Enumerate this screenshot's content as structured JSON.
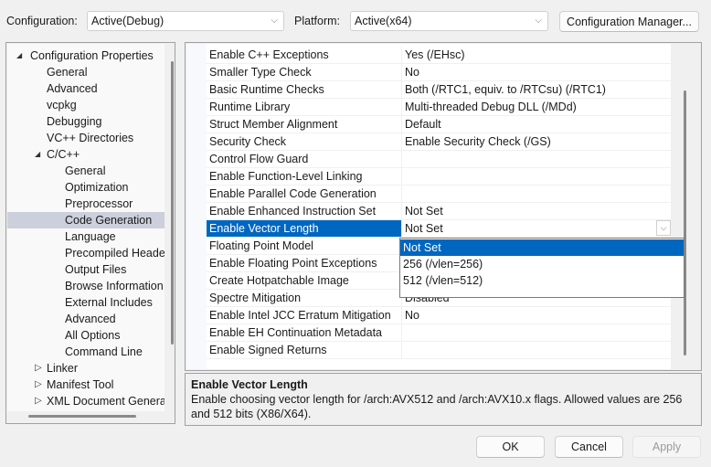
{
  "toolbar": {
    "configuration_label": "Configuration:",
    "configuration_value": "Active(Debug)",
    "platform_label": "Platform:",
    "platform_value": "Active(x64)",
    "config_manager_button": "Configuration Manager..."
  },
  "tree": {
    "nodes": [
      {
        "label": "Configuration Properties",
        "level": 0,
        "expander": "expanded"
      },
      {
        "label": "General",
        "level": 1
      },
      {
        "label": "Advanced",
        "level": 1
      },
      {
        "label": "vcpkg",
        "level": 1
      },
      {
        "label": "Debugging",
        "level": 1
      },
      {
        "label": "VC++ Directories",
        "level": 1
      },
      {
        "label": "C/C++",
        "level": 1,
        "expander": "expanded"
      },
      {
        "label": "General",
        "level": 2
      },
      {
        "label": "Optimization",
        "level": 2
      },
      {
        "label": "Preprocessor",
        "level": 2
      },
      {
        "label": "Code Generation",
        "level": 2,
        "selected": true
      },
      {
        "label": "Language",
        "level": 2
      },
      {
        "label": "Precompiled Heade",
        "level": 2
      },
      {
        "label": "Output Files",
        "level": 2
      },
      {
        "label": "Browse Information",
        "level": 2
      },
      {
        "label": "External Includes",
        "level": 2
      },
      {
        "label": "Advanced",
        "level": 2
      },
      {
        "label": "All Options",
        "level": 2
      },
      {
        "label": "Command Line",
        "level": 2
      },
      {
        "label": "Linker",
        "level": 1,
        "expander": "collapsed"
      },
      {
        "label": "Manifest Tool",
        "level": 1,
        "expander": "collapsed"
      },
      {
        "label": "XML Document Genera",
        "level": 1,
        "expander": "collapsed"
      }
    ]
  },
  "properties": {
    "rows": [
      {
        "name": "Enable C++ Exceptions",
        "value": "Yes (/EHsc)"
      },
      {
        "name": "Smaller Type Check",
        "value": "No"
      },
      {
        "name": "Basic Runtime Checks",
        "value": "Both (/RTC1, equiv. to /RTCsu) (/RTC1)"
      },
      {
        "name": "Runtime Library",
        "value": "Multi-threaded Debug DLL (/MDd)"
      },
      {
        "name": "Struct Member Alignment",
        "value": "Default"
      },
      {
        "name": "Security Check",
        "value": "Enable Security Check (/GS)"
      },
      {
        "name": "Control Flow Guard",
        "value": ""
      },
      {
        "name": "Enable Function-Level Linking",
        "value": ""
      },
      {
        "name": "Enable Parallel Code Generation",
        "value": ""
      },
      {
        "name": "Enable Enhanced Instruction Set",
        "value": "Not Set"
      },
      {
        "name": "Enable Vector Length",
        "value": "Not Set",
        "selected": true
      },
      {
        "name": "Floating Point Model",
        "value": ""
      },
      {
        "name": "Enable Floating Point Exceptions",
        "value": ""
      },
      {
        "name": "Create Hotpatchable Image",
        "value": ""
      },
      {
        "name": "Spectre Mitigation",
        "value": "Disabled"
      },
      {
        "name": "Enable Intel JCC Erratum Mitigation",
        "value": "No"
      },
      {
        "name": "Enable EH Continuation Metadata",
        "value": ""
      },
      {
        "name": "Enable Signed Returns",
        "value": ""
      }
    ]
  },
  "dropdown": {
    "options": [
      "Not Set",
      "256 (/vlen=256)",
      "512 (/vlen=512)"
    ],
    "selected_index": 0
  },
  "description": {
    "title": "Enable Vector Length",
    "text": "Enable choosing vector length for /arch:AVX512 and /arch:AVX10.x flags. Allowed values are 256 and 512 bits (X86/X64)."
  },
  "buttons": {
    "ok": "OK",
    "cancel": "Cancel",
    "apply": "Apply"
  },
  "colors": {
    "selection": "#0067c0",
    "tree_selection": "#ccd0dc"
  }
}
